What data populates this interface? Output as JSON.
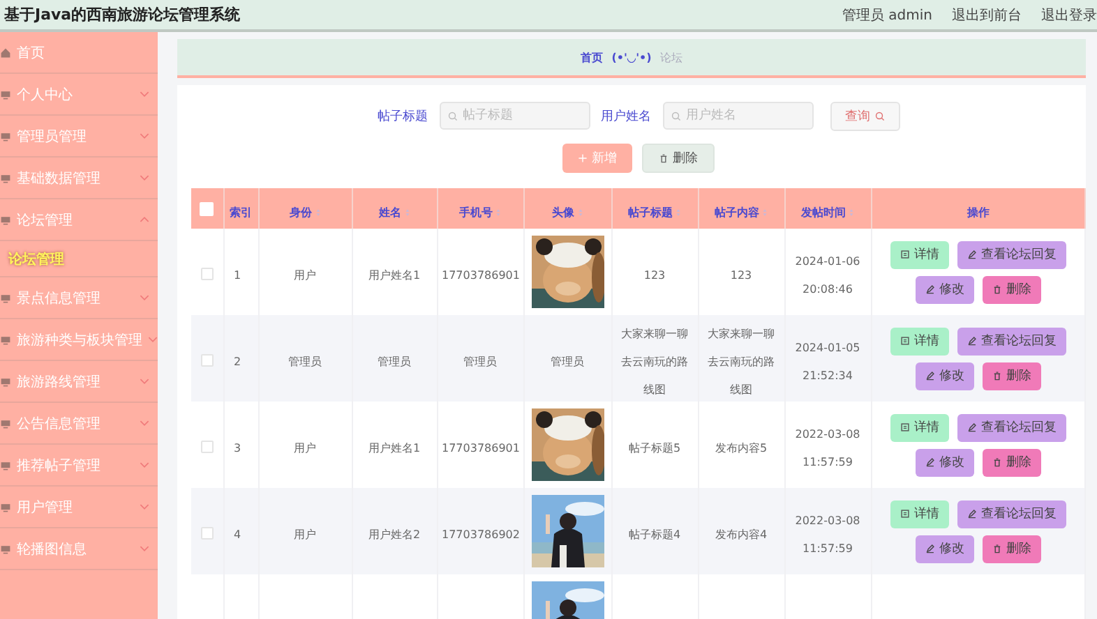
{
  "header": {
    "title": "基于Java的西南旅游论坛管理系统",
    "user": "管理员 admin",
    "links": [
      "退出到前台",
      "退出登录"
    ]
  },
  "sidebar": {
    "items": [
      {
        "label": "首页"
      },
      {
        "label": "个人中心",
        "expanded": false
      },
      {
        "label": "管理员管理",
        "expanded": false
      },
      {
        "label": "基础数据管理",
        "expanded": false
      },
      {
        "label": "论坛管理",
        "expanded": true,
        "children": [
          {
            "label": "论坛管理",
            "selected": true
          }
        ]
      },
      {
        "label": "景点信息管理",
        "expanded": false
      },
      {
        "label": "旅游种类与板块管理",
        "expanded": false
      },
      {
        "label": "旅游路线管理",
        "expanded": false
      },
      {
        "label": "公告信息管理",
        "expanded": false
      },
      {
        "label": "推荐帖子管理",
        "expanded": false
      },
      {
        "label": "用户管理",
        "expanded": false
      },
      {
        "label": "轮播图信息",
        "expanded": false
      }
    ]
  },
  "breadcrumb": [
    "首页",
    "(•'◡'•)",
    "论坛"
  ],
  "search": {
    "fields": [
      {
        "label": "帖子标题",
        "placeholder": "帖子标题"
      },
      {
        "label": "用户姓名",
        "placeholder": "用户姓名"
      }
    ],
    "button": "查询"
  },
  "toolbar": [
    {
      "kind": "add",
      "label": "新增"
    },
    {
      "kind": "delete",
      "label": "删除"
    }
  ],
  "table": {
    "header_checked": false,
    "columns": [
      {
        "label": "索引",
        "sortable": false
      },
      {
        "label": "身份",
        "sortable": true
      },
      {
        "label": "姓名",
        "sortable": true
      },
      {
        "label": "手机号",
        "sortable": true
      },
      {
        "label": "头像",
        "sortable": true
      },
      {
        "label": "帖子标题",
        "sortable": true
      },
      {
        "label": "帖子内容",
        "sortable": true
      },
      {
        "label": "发帖时间",
        "sortable": true
      },
      {
        "label": "操作",
        "sortable": false
      }
    ],
    "rows": [
      {
        "checked": false,
        "cells": [
          "1",
          "用户",
          "用户姓名1",
          "17703786901"
        ],
        "avatar": {
          "kind": "picture"
        },
        "after": [
          "123",
          "123",
          "2024-01-06 20:08:46"
        ],
        "actions": [
          {
            "kind": "detail",
            "label": "详情"
          },
          {
            "kind": "replies",
            "label": "查看论坛回复"
          },
          {
            "kind": "edit",
            "label": "修改"
          },
          {
            "kind": "delete",
            "label": "删除"
          }
        ]
      },
      {
        "checked": false,
        "cells": [
          "2",
          "管理员",
          "管理员",
          "管理员"
        ],
        "avatar": {
          "kind": "text",
          "text": "管理员"
        },
        "after": [
          "大家来聊一聊去云南玩的路线图",
          "大家来聊一聊去云南玩的路线图",
          "2024-01-05 21:52:34"
        ],
        "actions": [
          {
            "kind": "detail",
            "label": "详情"
          },
          {
            "kind": "replies",
            "label": "查看论坛回复"
          },
          {
            "kind": "edit",
            "label": "修改"
          },
          {
            "kind": "delete",
            "label": "删除"
          }
        ]
      },
      {
        "checked": false,
        "cells": [
          "3",
          "用户",
          "用户姓名1",
          "17703786901"
        ],
        "avatar": {
          "kind": "picture"
        },
        "after": [
          "帖子标题5",
          "发布内容5",
          "2022-03-08 11:57:59"
        ],
        "actions": [
          {
            "kind": "detail",
            "label": "详情"
          },
          {
            "kind": "replies",
            "label": "查看论坛回复"
          },
          {
            "kind": "edit",
            "label": "修改"
          },
          {
            "kind": "delete",
            "label": "删除"
          }
        ]
      },
      {
        "checked": false,
        "cells": [
          "4",
          "用户",
          "用户姓名2",
          "17703786902"
        ],
        "avatar": {
          "kind": "picture"
        },
        "after": [
          "帖子标题4",
          "发布内容4",
          "2022-03-08 11:57:59"
        ],
        "actions": [
          {
            "kind": "detail",
            "label": "详情"
          },
          {
            "kind": "replies",
            "label": "查看论坛回复"
          },
          {
            "kind": "edit",
            "label": "修改"
          },
          {
            "kind": "delete",
            "label": "删除"
          }
        ]
      },
      {
        "avatar": {
          "kind": "picture"
        }
      }
    ]
  }
}
